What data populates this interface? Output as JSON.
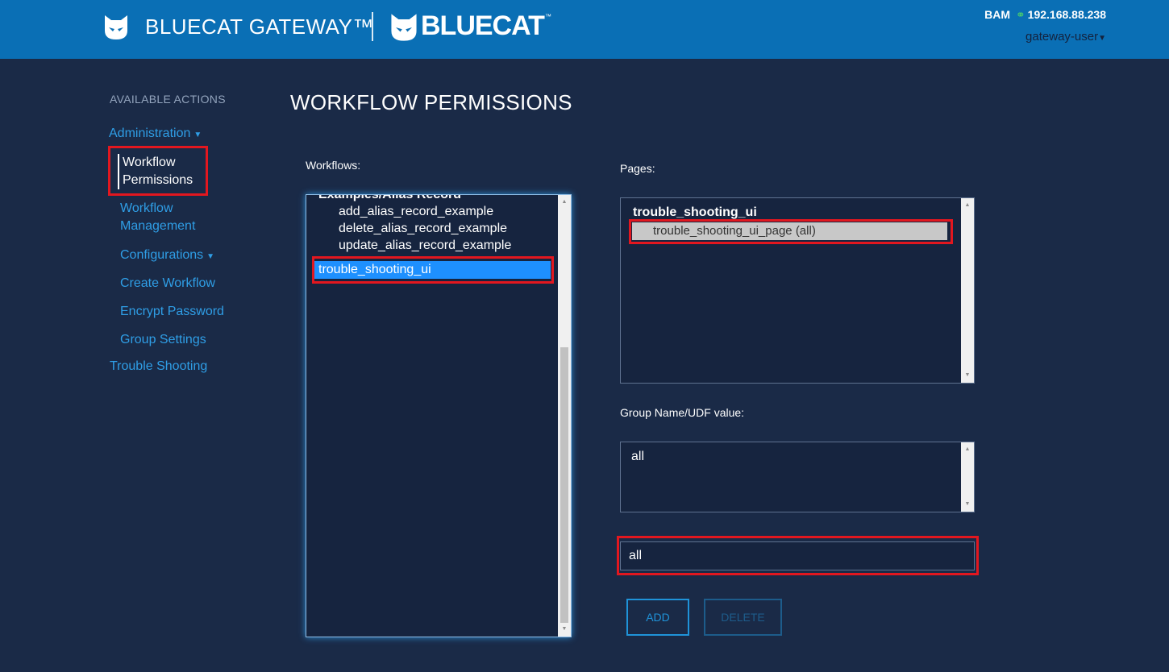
{
  "header": {
    "product_name": "BLUECAT GATEWAY™",
    "brand": "BLUECAT",
    "brand_tm": "™",
    "bam_label": "BAM",
    "bam_ip": "192.168.88.238",
    "user": "gateway-user",
    "colors": {
      "bar": "#0a6fb5"
    }
  },
  "sidebar": {
    "heading": "AVAILABLE ACTIONS",
    "administration": "Administration",
    "active_item_line1": "Workflow",
    "active_item_line2": "Permissions",
    "workflow_management_line1": "Workflow",
    "workflow_management_line2": "Management",
    "configurations": "Configurations",
    "create_workflow": "Create Workflow",
    "encrypt_password": "Encrypt Password",
    "group_settings": "Group Settings",
    "trouble_shooting": "Trouble Shooting"
  },
  "main": {
    "title": "WORKFLOW PERMISSIONS",
    "workflows_label": "Workflows:",
    "pages_label": "Pages:",
    "group_label": "Group Name/UDF value:",
    "workflows": {
      "group_header": "Examples/Alias Record",
      "items": [
        "add_alias_record_example",
        "delete_alias_record_example",
        "update_alias_record_example"
      ],
      "selected": "trouble_shooting_ui"
    },
    "pages": {
      "group_header": "trouble_shooting_ui",
      "selected": "trouble_shooting_ui_page (all)"
    },
    "groups": {
      "items": [
        "all"
      ]
    },
    "group_input_value": "all",
    "add_button": "ADD",
    "delete_button": "DELETE"
  },
  "colors": {
    "background": "#1a2a47",
    "link": "#2f9ee6",
    "highlight": "#e2171f",
    "selection": "#1e90ff"
  }
}
